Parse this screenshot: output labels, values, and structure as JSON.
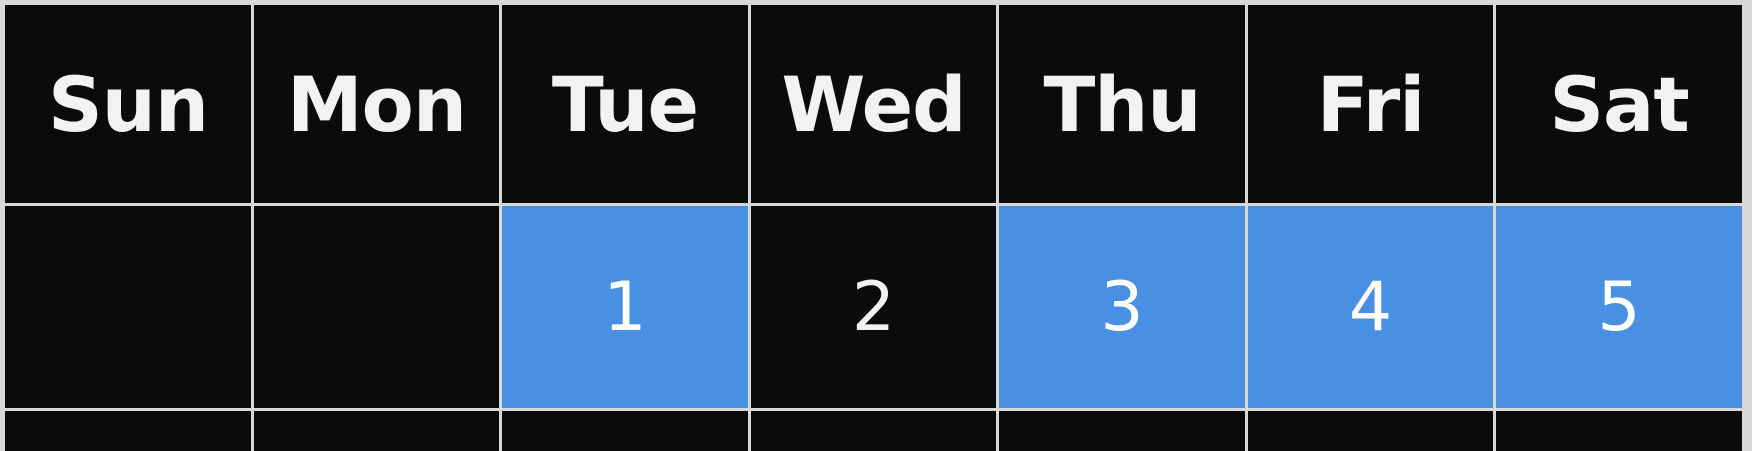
{
  "calendar": {
    "weekdays": [
      "Sun",
      "Mon",
      "Tue",
      "Wed",
      "Thu",
      "Fri",
      "Sat"
    ],
    "week1": [
      "",
      "",
      "1",
      "2",
      "3",
      "4",
      "5"
    ]
  },
  "colors": {
    "background": "#0b0b0b",
    "highlight": "#4a90e2",
    "grid_line": "#d8d8d8",
    "text": "#f2f2f2"
  }
}
